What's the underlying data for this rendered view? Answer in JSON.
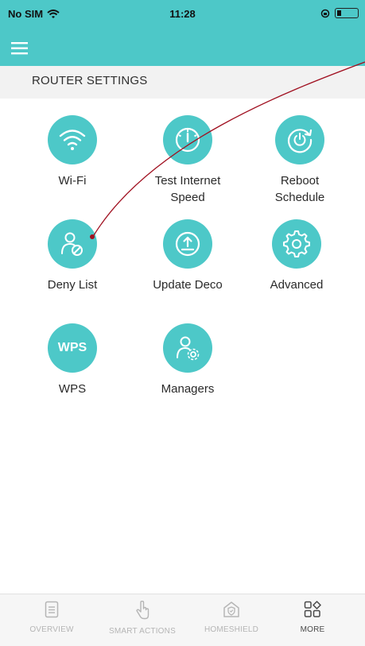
{
  "status_bar": {
    "carrier": "No SIM",
    "time": "11:28"
  },
  "section": {
    "title": "ROUTER SETTINGS"
  },
  "tiles": [
    {
      "label": "Wi-Fi",
      "icon": "wifi-icon"
    },
    {
      "label": "Test Internet\nSpeed",
      "icon": "speedometer-icon"
    },
    {
      "label": "Reboot\nSchedule",
      "icon": "reboot-icon"
    },
    {
      "label": "Deny List",
      "icon": "deny-user-icon"
    },
    {
      "label": "Update Deco",
      "icon": "upload-icon"
    },
    {
      "label": "Advanced",
      "icon": "gear-icon"
    },
    {
      "label": "WPS",
      "icon_text": "WPS",
      "icon": "wps-icon"
    },
    {
      "label": "Managers",
      "icon": "manager-icon"
    }
  ],
  "tab_bar": {
    "tabs": [
      {
        "label": "OVERVIEW",
        "icon": "document-icon"
      },
      {
        "label": "SMART ACTIONS",
        "icon": "hand-pointer-icon"
      },
      {
        "label": "HOMESHIELD",
        "icon": "home-shield-icon"
      },
      {
        "label": "MORE",
        "icon": "grid-icon",
        "active": true
      }
    ]
  },
  "colors": {
    "accent": "#4dc8c8",
    "annotation": "#a01020",
    "tab_inactive": "#b5b5b5"
  }
}
